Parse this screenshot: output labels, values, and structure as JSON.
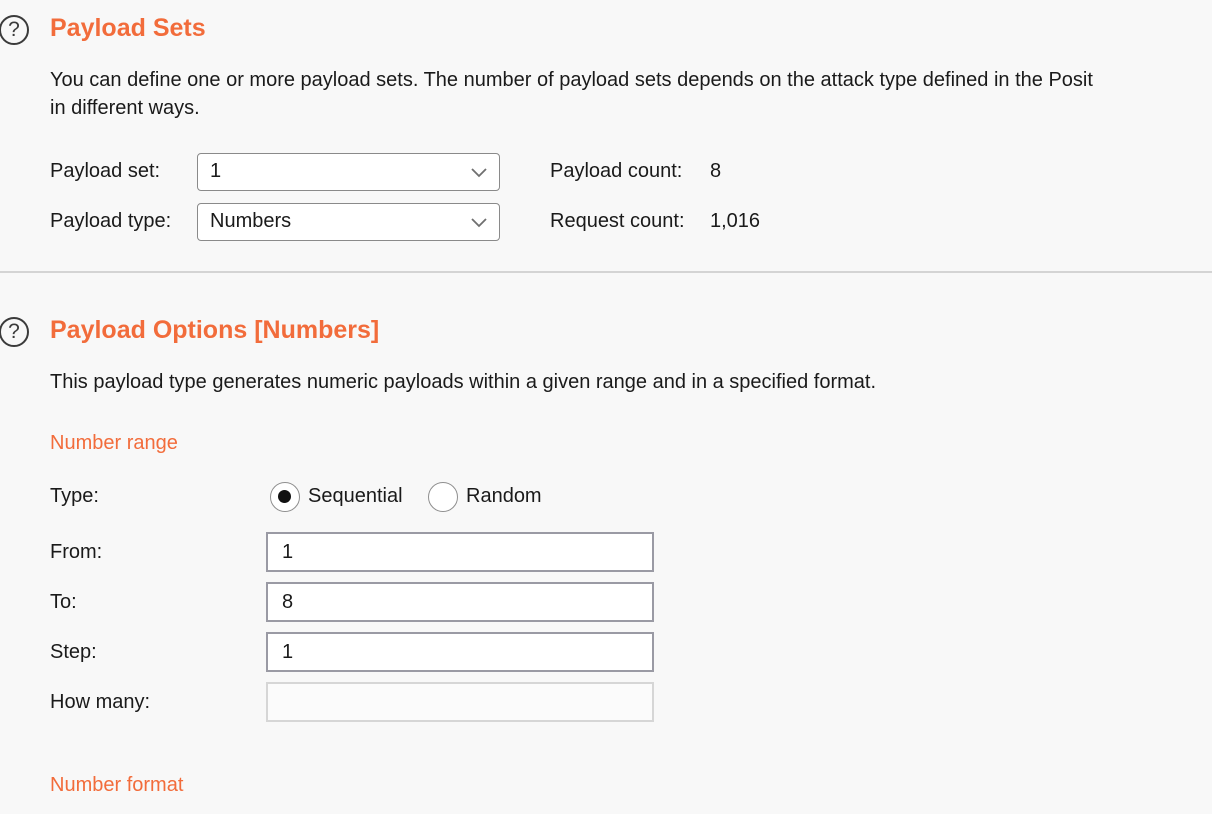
{
  "payload_sets": {
    "title": "Payload Sets",
    "description_line1": "You can define one or more payload sets. The number of payload sets depends on the attack type defined in the Posit",
    "description_line2": "in different ways.",
    "set_label": "Payload set:",
    "set_value": "1",
    "type_label": "Payload type:",
    "type_value": "Numbers",
    "payload_count_label": "Payload count:",
    "payload_count": "8",
    "request_count_label": "Request count:",
    "request_count": "1,016"
  },
  "payload_options": {
    "title": "Payload Options [Numbers]",
    "description": "This payload type generates numeric payloads within a given range and in a specified format.",
    "number_range": {
      "heading": "Number range",
      "type_label": "Type:",
      "sequential_label": "Sequential",
      "random_label": "Random",
      "selected_type": "Sequential",
      "from_label": "From:",
      "from_value": "1",
      "to_label": "To:",
      "to_value": "8",
      "step_label": "Step:",
      "step_value": "1",
      "how_many_label": "How many:",
      "how_many_value": ""
    },
    "number_format": {
      "heading": "Number format"
    }
  },
  "icons": {
    "help": "help-circle-icon",
    "dropdown": "chevron-down-icon"
  },
  "colors": {
    "accent": "#f26c3b",
    "background": "#f8f8f8"
  }
}
